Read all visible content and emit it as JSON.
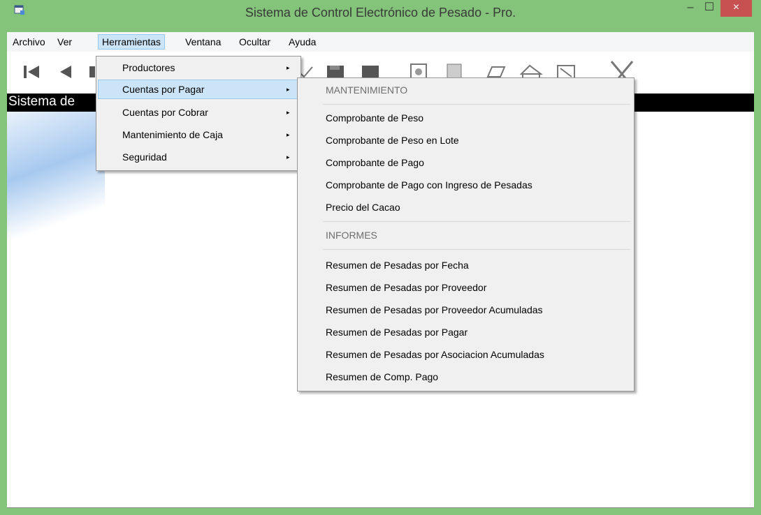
{
  "window": {
    "title": "Sistema de Control Electrónico de Pesado - Pro.",
    "minimize": "–",
    "maximize": "☐",
    "close": "×",
    "colors": {
      "frame": "#84c37a",
      "close": "#c75050",
      "highlight": "#cce4f7"
    }
  },
  "menubar": {
    "items": [
      "Archivo",
      "Ver",
      "Herramientas",
      "Ventana",
      "Ocultar",
      "Ayuda"
    ],
    "active": "Herramientas"
  },
  "toolbar": {
    "icons": [
      "first-record-icon",
      "previous-record-icon",
      "checkmark-icon",
      "save-icon",
      "delete-icon",
      "preview-icon",
      "document-icon",
      "print-icon",
      "export-icon",
      "close-form-icon",
      "exit-icon"
    ]
  },
  "banner": {
    "text": "Sistema de"
  },
  "herramientas_menu": {
    "items": [
      {
        "label": "Productores"
      },
      {
        "label": "Cuentas por Pagar"
      },
      {
        "label": "Cuentas por Cobrar"
      },
      {
        "label": "Mantenimiento de Caja"
      },
      {
        "label": "Seguridad"
      }
    ],
    "arrow": "▸"
  },
  "submenu": {
    "header_mantenimiento": "MANTENIMIENTO",
    "mantenimiento": [
      "Comprobante de Peso",
      "Comprobante de Peso en Lote",
      "Comprobante de Pago",
      "Comprobante de Pago con Ingreso de Pesadas",
      "Precio del Cacao"
    ],
    "header_informes": "INFORMES",
    "informes": [
      "Resumen de Pesadas por Fecha",
      "Resumen de Pesadas por Proveedor",
      "Resumen de Pesadas por Proveedor Acumuladas",
      "Resumen de Pesadas por Pagar",
      "Resumen de Pesadas por Asociacion Acumuladas",
      "Resumen de Comp. Pago"
    ]
  }
}
